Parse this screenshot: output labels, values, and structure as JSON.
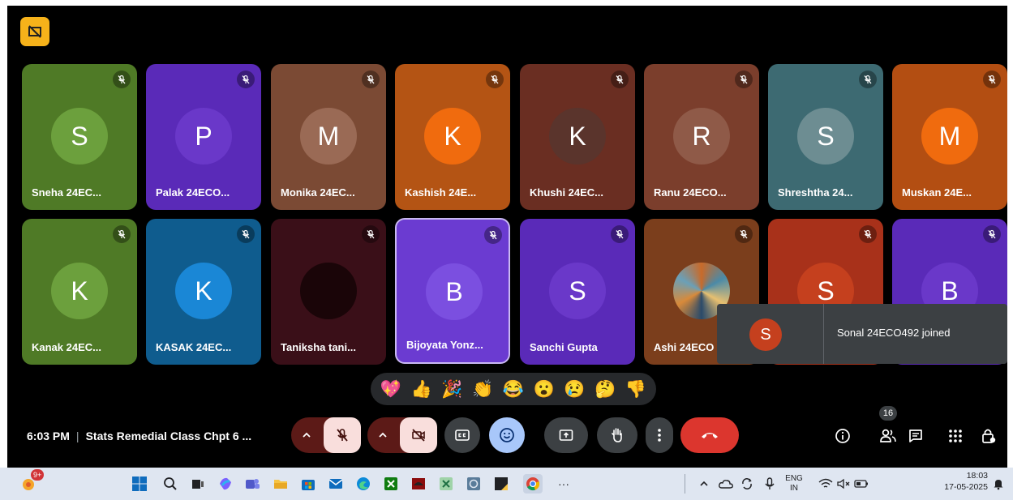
{
  "participants": [
    {
      "initial": "S",
      "name": "Sneha 24EC...",
      "bg": "#4f7a26",
      "avatar_color": "#6ca03d"
    },
    {
      "initial": "P",
      "name": "Palak 24ECO...",
      "bg": "#5a2ab8",
      "avatar_color": "#6a38c9"
    },
    {
      "initial": "M",
      "name": "Monika 24EC...",
      "bg": "#7b4a34",
      "avatar_color": "#9a6a55"
    },
    {
      "initial": "K",
      "name": "Kashish 24E...",
      "bg": "#b45414",
      "avatar_color": "#f06b0e"
    },
    {
      "initial": "K",
      "name": "Khushi 24EC...",
      "bg": "#6a2e22",
      "avatar_color": "#5a342c"
    },
    {
      "initial": "R",
      "name": "Ranu 24ECO...",
      "bg": "#7b3e2c",
      "avatar_color": "#8f5a48"
    },
    {
      "initial": "S",
      "name": "Shreshtha 24...",
      "bg": "#3d6a72",
      "avatar_color": "#6d8d92"
    },
    {
      "initial": "M",
      "name": "Muskan 24E...",
      "bg": "#b34e12",
      "avatar_color": "#f06b0e"
    },
    {
      "initial": "K",
      "name": "Kanak 24EC...",
      "bg": "#4f7a26",
      "avatar_color": "#6ca03d"
    },
    {
      "initial": "K",
      "name": "KASAK 24EC...",
      "bg": "#0f5c8e",
      "avatar_color": "#1a87d6"
    },
    {
      "initial": "",
      "name": "Taniksha tani...",
      "bg": "#3a0f18",
      "avatar_color": "#1a0508"
    },
    {
      "initial": "B",
      "name": "Bijoyata Yonz...",
      "bg": "#6b3bd1",
      "avatar_color": "#7b4fe0"
    },
    {
      "initial": "S",
      "name": "Sanchi Gupta",
      "bg": "#5a2ab8",
      "avatar_color": "#6a38c9"
    },
    {
      "initial": "",
      "name": "Ashi 24ECO",
      "bg": "#7b3e1c",
      "avatar_color": "#6a8a9a"
    },
    {
      "initial": "S",
      "name": "",
      "bg": "#a8311a",
      "avatar_color": "#c5401e"
    },
    {
      "initial": "B",
      "name": "",
      "bg": "#5a2ab8",
      "avatar_color": "#6a38c9"
    }
  ],
  "toast": {
    "initial": "S",
    "message": "Sonal 24ECO492 joined"
  },
  "reactions": [
    "💖",
    "👍",
    "🎉",
    "👏",
    "😂",
    "😮",
    "😢",
    "🤔",
    "👎"
  ],
  "meeting": {
    "time": "6:03 PM",
    "separator": "|",
    "title": "Stats Remedial Class Chpt 6 ..."
  },
  "people_count": "16",
  "colors": {
    "end_call": "#dc362e",
    "emoji_active": "#a8c7fa",
    "mic_muted_bg": "#f9dedc",
    "recording": "#f6b21a"
  },
  "taskbar": {
    "notification_badge": "9+",
    "more_label": "···",
    "lang_top": "ENG",
    "lang_bottom": "IN",
    "time": "18:03",
    "date": "17-05-2025"
  }
}
